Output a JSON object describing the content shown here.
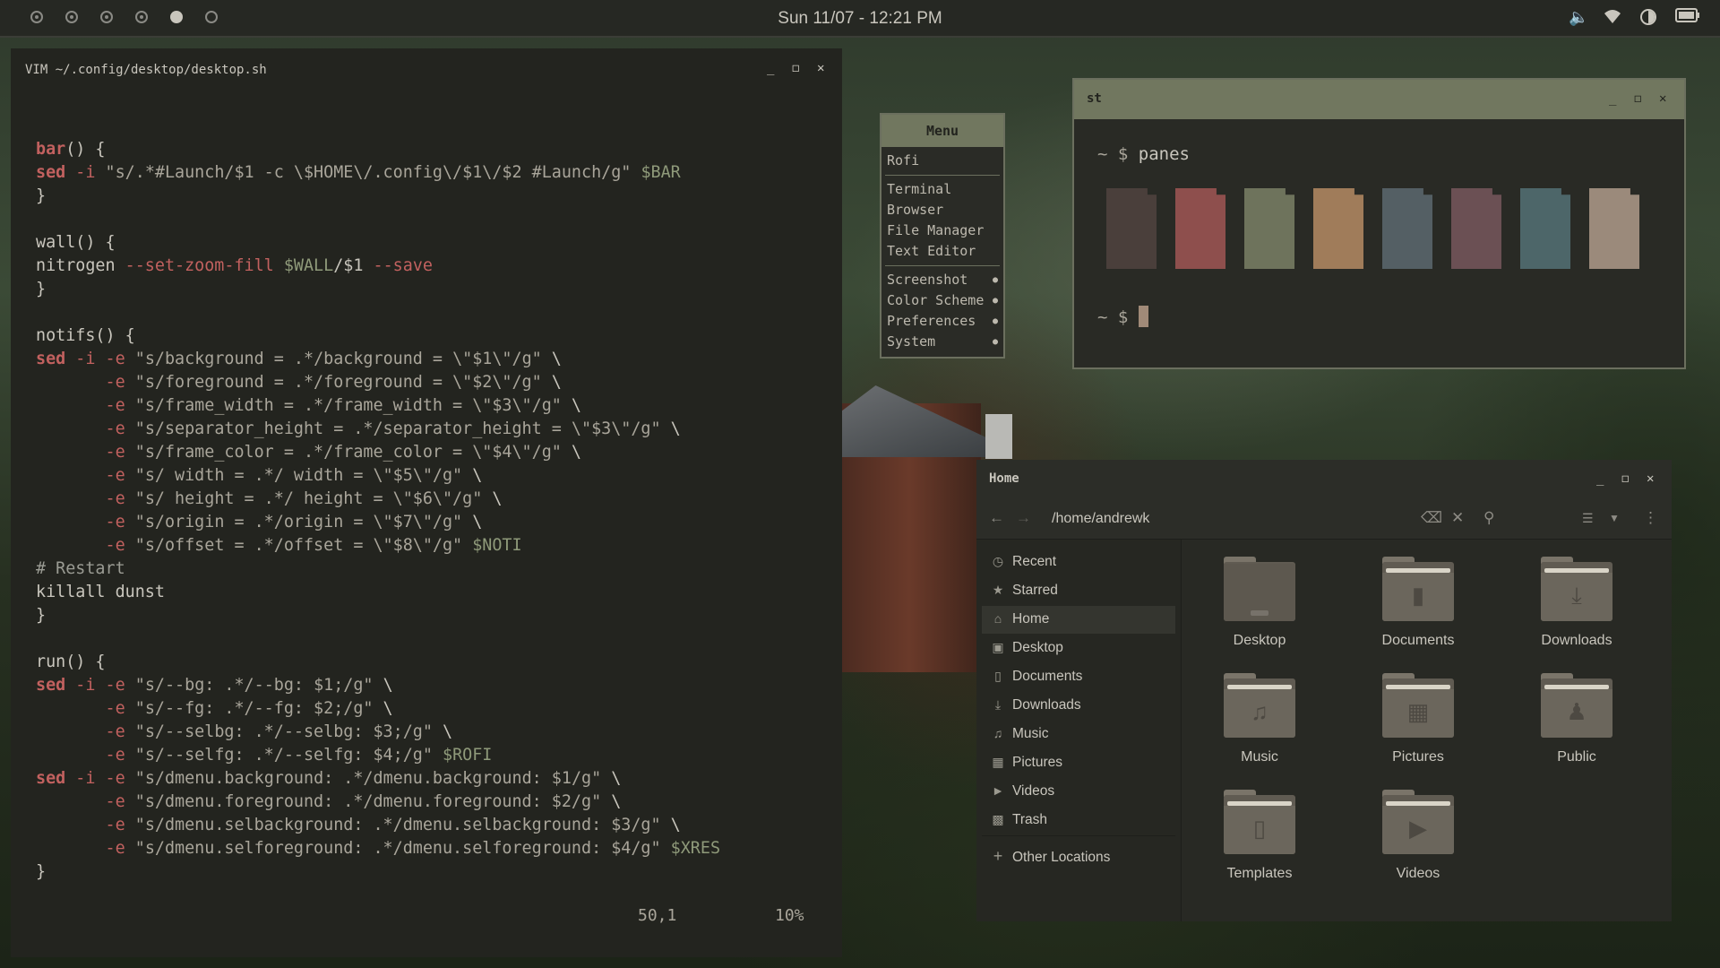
{
  "topbar": {
    "clock": "Sun 11/07 - 12:21 PM",
    "workspaces": [
      "ring",
      "ring",
      "ring",
      "ring",
      "filled",
      "empty"
    ],
    "tray": [
      "volume-icon",
      "wifi-icon",
      "brightness-icon",
      "battery-icon"
    ]
  },
  "vim": {
    "title": "VIM ~/.config/desktop/desktop.sh",
    "position": "50,1",
    "percent": "10%"
  },
  "menu": {
    "title": "Menu",
    "prompt": "Rofi",
    "items_group1": [
      "Terminal",
      "Browser",
      "File Manager",
      "Text Editor"
    ],
    "items_group2": [
      "Screenshot",
      "Color Scheme",
      "Preferences",
      "System"
    ]
  },
  "st": {
    "title": "st",
    "prompt1": "~ $ ",
    "command1": "panes",
    "prompt2": "~ $ ",
    "pane_colors": [
      "#4a3f3b",
      "#8e4f4d",
      "#6e735c",
      "#a07c5a",
      "#545f64",
      "#6b5054",
      "#4d6669",
      "#9b8a7b"
    ]
  },
  "fm": {
    "title": "Home",
    "path": "/home/andrewk",
    "sidebar": [
      {
        "label": "Recent",
        "icon": "clock-icon"
      },
      {
        "label": "Starred",
        "icon": "star-icon"
      },
      {
        "label": "Home",
        "icon": "home-icon"
      },
      {
        "label": "Desktop",
        "icon": "desktop-icon"
      },
      {
        "label": "Documents",
        "icon": "document-icon"
      },
      {
        "label": "Downloads",
        "icon": "download-icon"
      },
      {
        "label": "Music",
        "icon": "music-icon"
      },
      {
        "label": "Pictures",
        "icon": "picture-icon"
      },
      {
        "label": "Videos",
        "icon": "video-icon"
      },
      {
        "label": "Trash",
        "icon": "trash-icon"
      }
    ],
    "other_locations": "Other Locations",
    "folders": [
      "Desktop",
      "Documents",
      "Downloads",
      "Music",
      "Pictures",
      "Public",
      "Templates",
      "Videos"
    ]
  },
  "colors": {
    "accent": "#71775f",
    "keyword": "#c2615f",
    "background": "#23241f"
  }
}
